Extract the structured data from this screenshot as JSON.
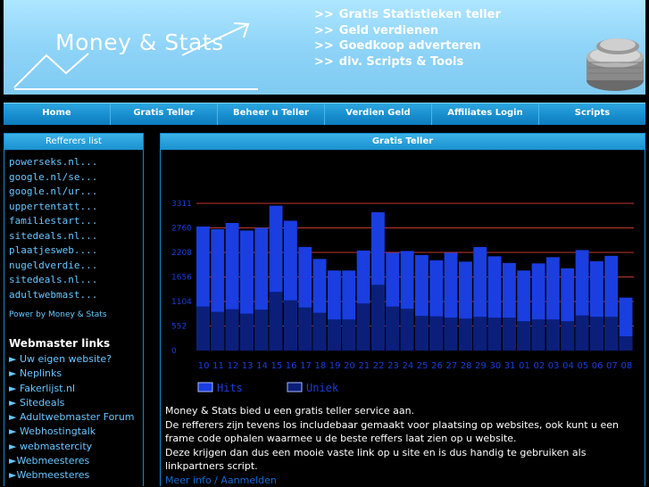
{
  "header": {
    "title": "Money & Stats",
    "bullets": [
      "Gratis Statistieken teller",
      "Geld verdienen",
      "Goedkoop adverteren",
      "div. Scripts & Tools"
    ],
    "chevron": ">>"
  },
  "nav": [
    "Home",
    "Gratis Teller",
    "Beheer u Teller",
    "Verdien Geld",
    "Affiliates Login",
    "Scripts"
  ],
  "sidebar": {
    "title": "Refferers list",
    "referrers": [
      "powerseks.nl...",
      "google.nl/se...",
      "google.nl/ur...",
      "uppertentatt...",
      "familiestart...",
      "sitedeals.nl...",
      "plaatjesweb....",
      "nugeldverdie...",
      "sitedeals.nl...",
      "adultwebmast..."
    ],
    "powered_by": "Power by Money & Stats",
    "webmaster_title": "Webmaster links",
    "webmaster_links": [
      "► Uw eigen website?",
      "► Neplinks",
      "► Fakerlijst.nl",
      "► Sitedeals",
      "► Adultwebmaster Forum",
      "► Webhostingtalk",
      "► webmastercity",
      "►Webmeesteres",
      "►Webmeesteres"
    ]
  },
  "main": {
    "title": "Gratis Teller",
    "paragraphs": [
      "Money & Stats bied u een gratis teller service aan.",
      "De refferers zijn tevens los includebaar gemaakt voor plaatsing op websites, ook kunt u een frame code ophalen waarmee u de beste reffers laat zien op u website.",
      "Deze krijgen dan dus een mooie vaste link op u site en is dus handig te gebruiken als linkpartners script."
    ],
    "more_link": "Meer info / Aanmelden"
  },
  "colors": {
    "hits": "#1a3ee0",
    "uniek": "#0b1f7a",
    "gridline": "#c0392b",
    "axis_text": "#1a3ee0"
  },
  "chart_data": {
    "type": "bar",
    "categories": [
      "10",
      "11",
      "12",
      "13",
      "14",
      "15",
      "16",
      "17",
      "18",
      "19",
      "20",
      "21",
      "22",
      "23",
      "24",
      "25",
      "26",
      "27",
      "28",
      "29",
      "30",
      "31",
      "01",
      "02",
      "03",
      "04",
      "05",
      "06",
      "07",
      "08"
    ],
    "series": [
      {
        "name": "Hits",
        "values": [
          2790,
          2730,
          2870,
          2700,
          2760,
          3260,
          2920,
          2330,
          2060,
          1800,
          1800,
          2250,
          3110,
          2200,
          2240,
          2150,
          2030,
          2200,
          2000,
          2330,
          2120,
          1970,
          1800,
          1960,
          2100,
          1850,
          2260,
          2010,
          2130,
          1190
        ]
      },
      {
        "name": "Uniek",
        "values": [
          990,
          870,
          930,
          830,
          920,
          1320,
          1130,
          970,
          850,
          700,
          700,
          1060,
          1480,
          990,
          940,
          780,
          770,
          740,
          720,
          760,
          740,
          740,
          660,
          700,
          700,
          660,
          790,
          760,
          760,
          320
        ]
      }
    ],
    "yticks": [
      0,
      552,
      1104,
      1656,
      2208,
      2760,
      3311
    ],
    "ylim": [
      0,
      3311
    ]
  }
}
